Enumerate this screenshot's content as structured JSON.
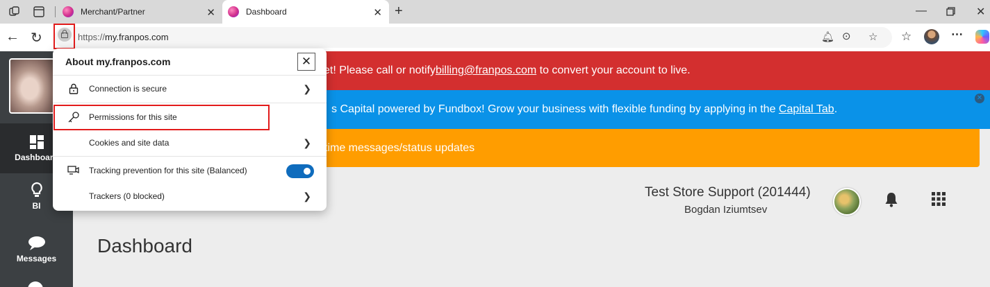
{
  "browser": {
    "tabs": [
      {
        "title": "Merchant/Partner",
        "active": false
      },
      {
        "title": "Dashboard",
        "active": true
      }
    ],
    "url_scheme": "https://",
    "url_host": "my.franpos.com"
  },
  "site_info": {
    "title": "About my.franpos.com",
    "close_glyph": "✕",
    "rows": [
      {
        "label": "Connection is secure",
        "icon": "lock-icon"
      },
      {
        "label": "Permissions for this site",
        "icon": "key-icon"
      },
      {
        "label": "Cookies and site data",
        "icon": ""
      },
      {
        "label": "Tracking prevention for this site (Balanced)",
        "icon": "tracking-icon",
        "toggle": "on"
      },
      {
        "label": "Trackers (0 blocked)",
        "icon": ""
      }
    ]
  },
  "banners": {
    "red": {
      "text_before": "et! Please call or notify ",
      "link": "billing@franpos.com",
      "text_after": " to convert your account to live.",
      "color": "#d32f2f"
    },
    "blue": {
      "text_before": "s Capital powered by Fundbox! Grow your business with flexible funding by applying in the ",
      "link": "Capital Tab",
      "text_after": ".",
      "color": "#0a92e8"
    },
    "orange": {
      "text": "time messages/status updates",
      "color": "#ff9d00"
    }
  },
  "sidebar": {
    "items": [
      {
        "label": "Dashboard",
        "icon": "dashboard-icon",
        "active": true
      },
      {
        "label": "BI",
        "icon": "lightbulb-icon"
      },
      {
        "label": "Messages",
        "icon": "chat-icon"
      }
    ]
  },
  "header": {
    "store": "Test Store Support (201444)",
    "user": "Bogdan Iziumtsev"
  },
  "page": {
    "title": "Dashboard"
  }
}
